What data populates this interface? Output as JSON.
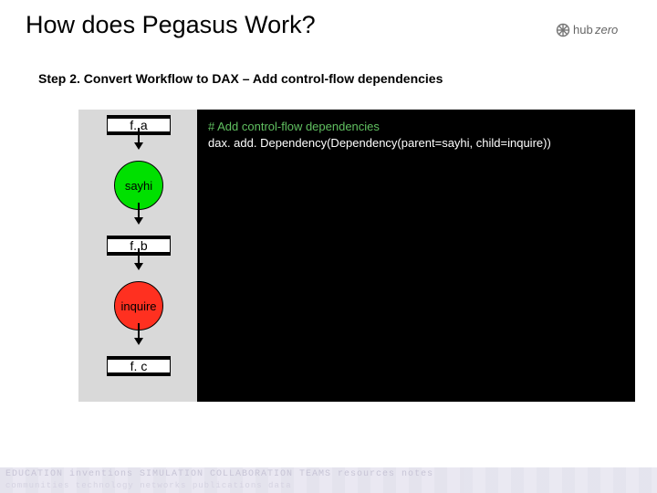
{
  "title": "How does Pegasus Work?",
  "step_line": "Step 2. Convert Workflow to DAX – Add control-flow dependencies",
  "code": {
    "line1": "# Add control-flow dependencies",
    "line2": "dax. add. Dependency(Dependency(parent=sayhi, child=inquire))"
  },
  "workflow": {
    "fa": "f. a",
    "sayhi": "sayhi",
    "fb": "f. b",
    "inquire": "inquire",
    "fc": "f. c"
  },
  "footer": {
    "row1": "EDUCATION  inventions  SIMULATION  COLLABORATION  TEAMS  resources  notes",
    "row2": "communities  technology  networks  publications  data"
  },
  "page_indicator": "",
  "logo_text": "hubzero"
}
